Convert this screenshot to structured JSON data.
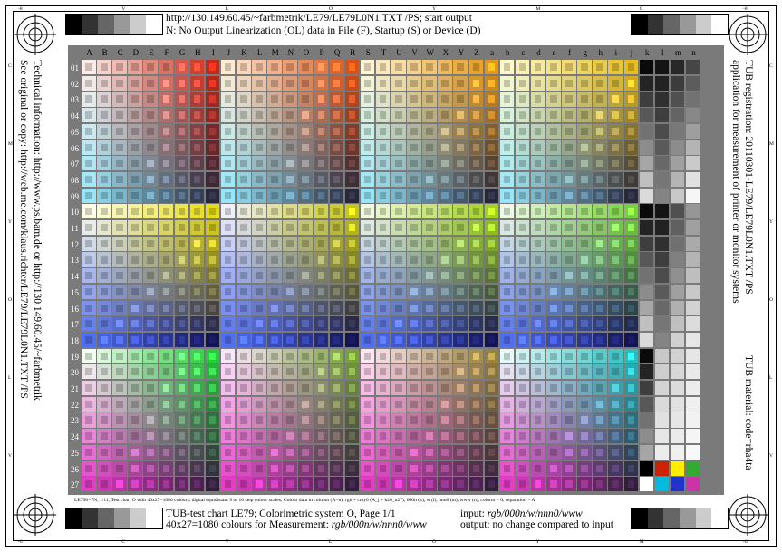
{
  "header": {
    "line1": "http://130.149.60.45/~farbmetrik/LE79/LE79L0N1.TXT /PS; start output",
    "line2": "N: No Output Linearization (OL) data in File (F), Startup (S) or Device (D)"
  },
  "left_side": {
    "line1": "See original or copy: http://web.me.com/klaus.richter/LE79/LE79L0N1.TXT /PS",
    "line2": "Technical information: http://www.ps.bam.de or http://130.149.60.45/~farbmetrik"
  },
  "right_side": {
    "line1": "TUB registration: 20110301-LE79/LE79L0N1.TXT /PS",
    "line2": "application for measurement of printer or monitor systems",
    "material": "TUB material: code=rha4ta"
  },
  "chart_info": "LE790−7N, 1/11, Test chart O with 40x27=1080 colours; digital equidistant 9 or 16 step colour scales; Colour data in column (A−n): rgb + cmy0 (A_j + k26_n27), 000n (k), w (l), nnn0 (m), www (n), colorm = 0, separation = A",
  "footer": {
    "left1": "TUB-test chart LE79; Colorimetric system O, Page 1/1",
    "left2_prefix": "40x27=1080 colours for Measurement: ",
    "left2_em": "rgb/000n/w/nnn0/www",
    "right1_prefix": "input: ",
    "right1_em": "rgb/000n/w/nnn0/www",
    "right2": "output: no change compared to input"
  },
  "columns": [
    "A",
    "B",
    "C",
    "D",
    "E",
    "F",
    "G",
    "H",
    "I",
    "J",
    "K",
    "L",
    "M",
    "N",
    "O",
    "P",
    "Q",
    "R",
    "S",
    "T",
    "U",
    "V",
    "W",
    "X",
    "Y",
    "Z",
    "a",
    "b",
    "c",
    "d",
    "e",
    "f",
    "g",
    "h",
    "i",
    "j",
    "k",
    "l",
    "m",
    "n"
  ],
  "rows": [
    "01",
    "02",
    "03",
    "04",
    "05",
    "06",
    "07",
    "08",
    "09",
    "10",
    "11",
    "12",
    "13",
    "14",
    "15",
    "16",
    "17",
    "18",
    "19",
    "20",
    "21",
    "22",
    "23",
    "24",
    "25",
    "26",
    "27"
  ],
  "margin_letters": {
    "top": [
      "-8",
      "V",
      "L",
      "O",
      "Y",
      "M",
      "C",
      "-8"
    ],
    "bottom": [
      "-6",
      "C",
      "V",
      "L",
      "O",
      "Y",
      "M",
      "-6"
    ],
    "left": [
      "C",
      "M",
      "Y",
      "O",
      "L",
      "V"
    ],
    "right": [
      "C",
      "M",
      "Y",
      "O",
      "L",
      "V"
    ]
  },
  "colors": {
    "grayscale": [
      "#000000",
      "#333333",
      "#666666",
      "#999999",
      "#cccccc",
      "#ffffff"
    ],
    "corner_patches": [
      "#000000",
      "#cc2200",
      "#ffee00",
      "#33aa33",
      "#00bbdd",
      "#2233cc",
      "#cc33aa"
    ]
  }
}
